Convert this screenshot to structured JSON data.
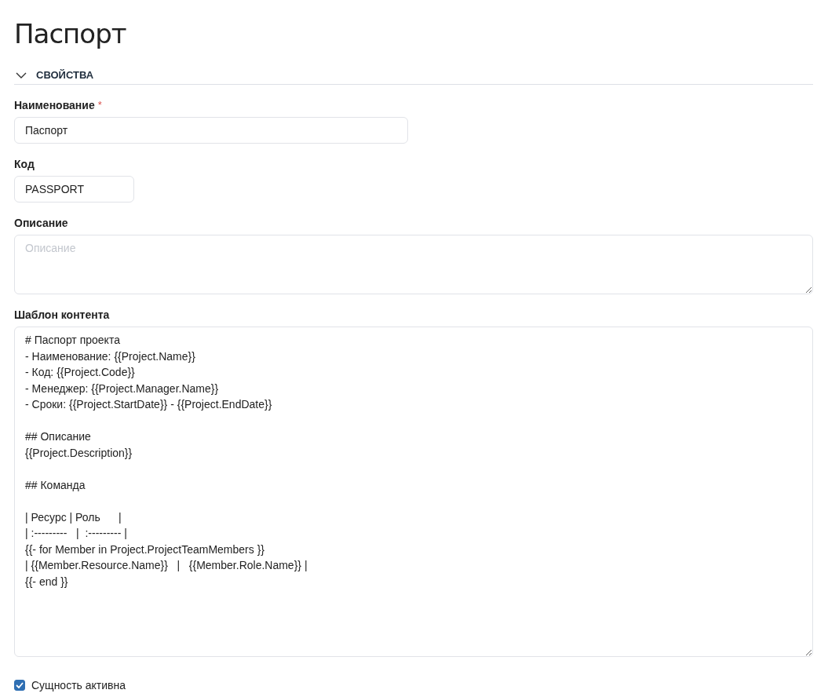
{
  "page": {
    "title": "Паспорт"
  },
  "section": {
    "title": "СВОЙСТВА",
    "expanded": true
  },
  "fields": [
    {
      "kind": "input",
      "label": "Наименование",
      "required_mark": "*",
      "value": "Паспорт"
    },
    {
      "kind": "input",
      "label": "Код",
      "value": "PASSPORT"
    },
    {
      "kind": "textarea",
      "label": "Описание",
      "placeholder": "Описание"
    },
    {
      "kind": "textarea",
      "label": "Шаблон контента",
      "value": "# Паспорт проекта\n- Наименование: {{Project.Name}}\n- Код: {{Project.Code}}\n- Менеджер: {{Project.Manager.Name}}\n- Сроки: {{Project.StartDate}} - {{Project.EndDate}}\n\n## Описание\n{{Project.Description}}\n\n## Команда\n\n| Ресурс | Роль      |\n| :---------   |  :--------- |\n{{- for Member in Project.ProjectTeamMembers }}\n| {{Member.Resource.Name}}   |   {{Member.Role.Name}} |\n{{- end }}"
    }
  ],
  "checkbox": {
    "label": "Сущность активна",
    "checked": true
  }
}
